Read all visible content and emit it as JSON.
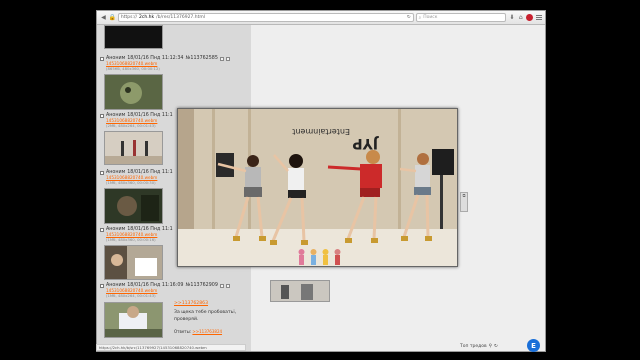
{
  "browser": {
    "url_scheme": "https://",
    "url_domain": "2ch.hk",
    "url_rest": "/b/res/11376927.html",
    "search_placeholder": "Поиск"
  },
  "posts": [
    {
      "author": "Аноним",
      "date": "18/01/16 Пнд 11:12:34",
      "number": "№113762585",
      "file_link": "14531068820740.webm",
      "file_meta": "(865Кб, 480x360, 00:00:12)",
      "thumb_color": "#7c8a56"
    },
    {
      "author": "Аноним",
      "date": "18/01/16 Пнд 11:1",
      "file_link": "14531068820740.webm",
      "file_meta": "(2Мб, 480x264, 00:01:43)",
      "thumb_color": "#cfc6ba"
    },
    {
      "author": "Аноним",
      "date": "18/01/16 Пнд 11:1",
      "file_link": "14531068820740.webm",
      "file_meta": "(1Мб, 480x360, 00:00:30)",
      "thumb_color": "#3c4a2e"
    },
    {
      "author": "Аноним",
      "date": "18/01/16 Пнд 11:1",
      "file_link": "14531068820740.webm",
      "file_meta": "(1Мб, 480x360, 00:00:16)",
      "thumb_color": "#9a8c7c"
    },
    {
      "author": "Аноним",
      "date": "18/01/16 Пнд 11:16:09",
      "number": "№113762909",
      "file_link": "14531068820740.webm",
      "file_meta": "(1Мб, 480x264, 00:01:43)",
      "reply_ref": ">>113762863",
      "text_line1": "За щека тебе пробоватьі,",
      "text_line2": "проверяй.",
      "answers_label": "Ответы:",
      "answers_link": ">>113763824",
      "thumb_color": "#6c7a5a"
    }
  ],
  "overlay": {
    "video_sign": "Entertainment",
    "video_logo": "JYP"
  },
  "status_bar": {
    "url": "https://2ch.hk/b/src/113769927/14531068820740.webm"
  },
  "find_bar": {
    "label": "Топ тредов"
  },
  "colors": {
    "link": "#ff6600",
    "thread_bg": "#d9d9d9",
    "page_bg": "#eeeeee"
  }
}
